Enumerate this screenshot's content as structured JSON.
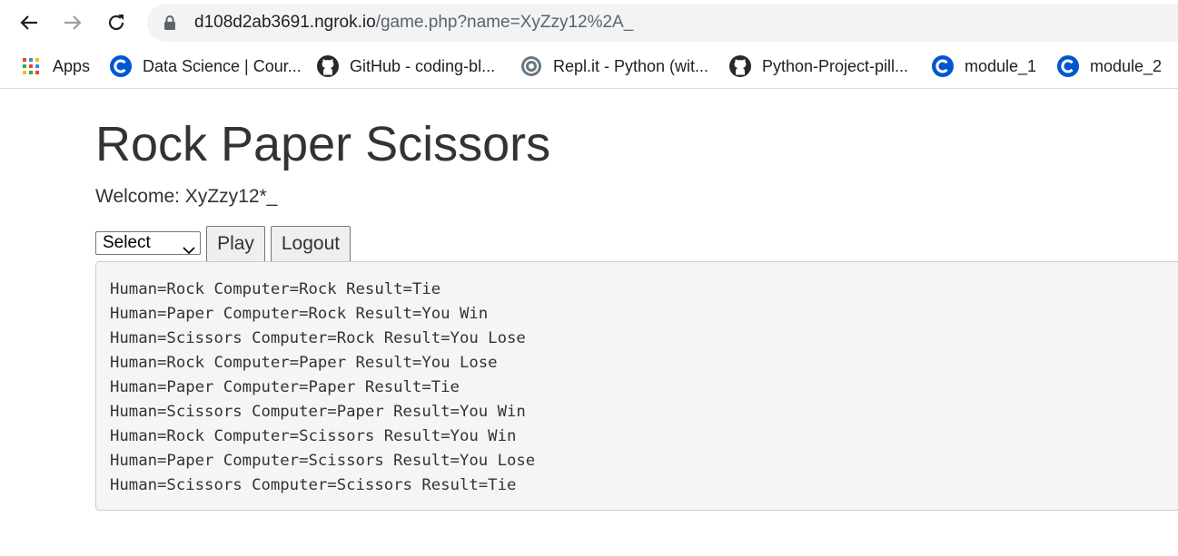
{
  "browser": {
    "url_host": "d108d2ab3691.ngrok.io",
    "url_path": "/game.php?name=XyZzy12%2A_",
    "bookmarks": [
      {
        "label": "Apps",
        "icon": "apps-grid-icon"
      },
      {
        "label": "Data Science | Cour...",
        "icon": "coursera-icon"
      },
      {
        "label": "GitHub - coding-bl...",
        "icon": "github-icon"
      },
      {
        "label": "Repl.it - Python (wit...",
        "icon": "replit-icon"
      },
      {
        "label": "Python-Project-pill...",
        "icon": "github-icon"
      },
      {
        "label": "module_1",
        "icon": "coursera-icon"
      },
      {
        "label": "module_2",
        "icon": "coursera-icon"
      }
    ]
  },
  "page": {
    "title": "Rock Paper Scissors",
    "welcome": "Welcome: XyZzy12*_",
    "select_value": "Select",
    "play_label": "Play",
    "logout_label": "Logout",
    "results": [
      "Human=Rock Computer=Rock Result=Tie",
      "Human=Paper Computer=Rock Result=You Win",
      "Human=Scissors Computer=Rock Result=You Lose",
      "Human=Rock Computer=Paper Result=You Lose",
      "Human=Paper Computer=Paper Result=Tie",
      "Human=Scissors Computer=Paper Result=You Win",
      "Human=Rock Computer=Scissors Result=You Win",
      "Human=Paper Computer=Scissors Result=You Lose",
      "Human=Scissors Computer=Scissors Result=Tie"
    ]
  },
  "colors": {
    "coursera_blue": "#0056d2",
    "omnibox_bg": "#f1f3f4",
    "results_bg": "#f5f5f5"
  }
}
